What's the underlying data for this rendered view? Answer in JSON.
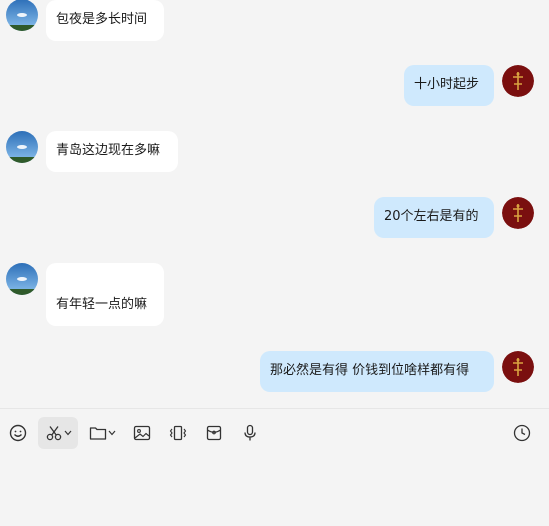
{
  "messages": [
    {
      "side": "left",
      "text": "包夜是多长时间"
    },
    {
      "side": "right",
      "text": "十小时起步"
    },
    {
      "side": "left",
      "text": "青岛这边现在多嘛"
    },
    {
      "side": "right",
      "text": "20个左右是有的"
    },
    {
      "side": "left",
      "text": "有年轻一点的嘛"
    },
    {
      "side": "right",
      "text": "那必然是有得 价钱到位啥样都有得"
    }
  ],
  "toolbar": {
    "icons": [
      "emoji-icon",
      "scissors-icon",
      "folder-icon",
      "image-icon",
      "vibrate-icon",
      "red-packet-icon",
      "microphone-icon",
      "history-clock-icon"
    ]
  },
  "colors": {
    "background": "#f4f4f4",
    "bubble_incoming": "#ffffff",
    "bubble_outgoing": "#cfe9fd",
    "avatar_self": "#7a0f0f",
    "avatar_other": "#3a7fc4"
  }
}
